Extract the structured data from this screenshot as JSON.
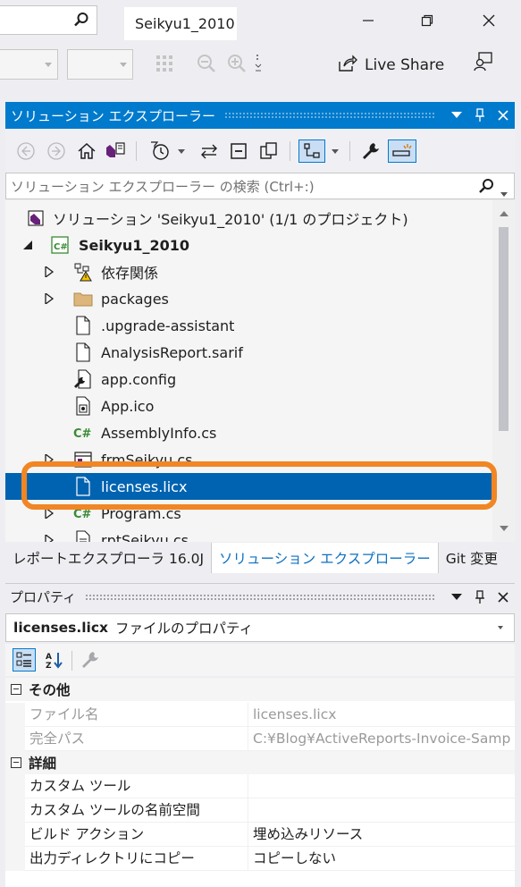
{
  "window": {
    "title": "Seikyu1_2010",
    "live_share_label": "Live Share"
  },
  "solution_explorer": {
    "header": "ソリューション エクスプローラー",
    "search_placeholder": "ソリューション エクスプローラー の検索 (Ctrl+:)",
    "tree": [
      {
        "label": "ソリューション 'Seikyu1_2010' (1/1 のプロジェクト)",
        "icon": "solution-icon"
      },
      {
        "label": "Seikyu1_2010",
        "icon": "csharp-project-icon"
      },
      {
        "label": "依存関係",
        "icon": "dependencies-icon"
      },
      {
        "label": "packages",
        "icon": "folder-icon"
      },
      {
        "label": ".upgrade-assistant",
        "icon": "file-icon"
      },
      {
        "label": "AnalysisReport.sarif",
        "icon": "file-icon"
      },
      {
        "label": "app.config",
        "icon": "config-icon"
      },
      {
        "label": "App.ico",
        "icon": "ico-file-icon"
      },
      {
        "label": "AssemblyInfo.cs",
        "icon": "csharp-file-icon"
      },
      {
        "label": "frmSeikyu.cs",
        "icon": "form-icon"
      },
      {
        "label": "licenses.licx",
        "icon": "file-icon",
        "selected": true
      },
      {
        "label": "Program.cs",
        "icon": "csharp-file-icon"
      },
      {
        "label": "rptSeikyu.cs",
        "icon": "report-icon"
      }
    ]
  },
  "bottom_tabs": [
    {
      "label": "レポートエクスプローラ 16.0J"
    },
    {
      "label": "ソリューション エクスプローラー",
      "active": true
    },
    {
      "label": "Git 変更"
    }
  ],
  "properties": {
    "header": "プロパティ",
    "object_name": "licenses.licx",
    "object_type": "ファイルのプロパティ",
    "categories": [
      {
        "name": "その他",
        "rows": [
          {
            "name": "ファイル名",
            "value": "licenses.licx"
          },
          {
            "name": "完全パス",
            "value": "C:¥Blog¥ActiveReports-Invoice-Samp"
          }
        ]
      },
      {
        "name": "詳細",
        "rows": [
          {
            "name": "カスタム ツール",
            "value": ""
          },
          {
            "name": "カスタム ツールの名前空間",
            "value": ""
          },
          {
            "name": "ビルド アクション",
            "value": "埋め込みリソース"
          },
          {
            "name": "出力ディレクトリにコピー",
            "value": "コピーしない"
          }
        ]
      }
    ]
  },
  "colors": {
    "accent": "#007acc",
    "selection": "#0063b1",
    "highlight": "#f08624",
    "csharp_green": "#388a34",
    "vs_purple": "#68217a"
  }
}
